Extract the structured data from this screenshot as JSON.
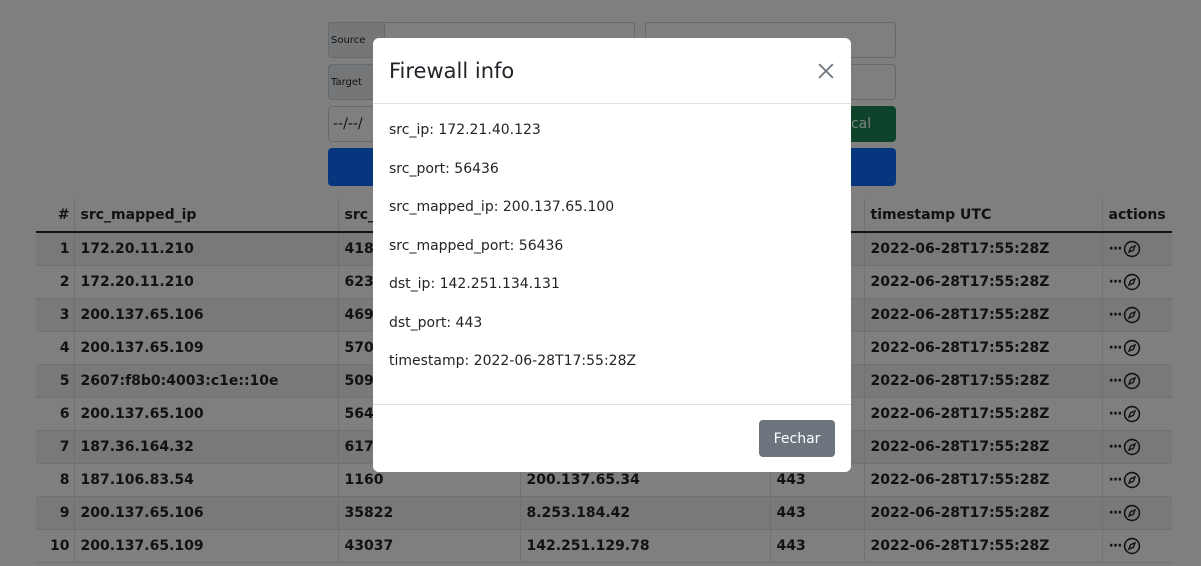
{
  "form": {
    "source_label": "Source",
    "target_label": "Target",
    "date_value": "--/--/",
    "local_button": "Local"
  },
  "table": {
    "headers": [
      "#",
      "src_mapped_ip",
      "src_",
      "",
      "",
      "timestamp UTC",
      "actions"
    ],
    "rows": [
      {
        "n": "1",
        "ip": "172.20.11.210",
        "port": "418",
        "dst": "",
        "dport": "",
        "ts": "2022-06-28T17:55:28Z"
      },
      {
        "n": "2",
        "ip": "172.20.11.210",
        "port": "623",
        "dst": "",
        "dport": "",
        "ts": "2022-06-28T17:55:28Z"
      },
      {
        "n": "3",
        "ip": "200.137.65.106",
        "port": "469",
        "dst": "",
        "dport": "",
        "ts": "2022-06-28T17:55:28Z"
      },
      {
        "n": "4",
        "ip": "200.137.65.109",
        "port": "570",
        "dst": "",
        "dport": "",
        "ts": "2022-06-28T17:55:28Z"
      },
      {
        "n": "5",
        "ip": "2607:f8b0:4003:c1e::10e",
        "port": "509",
        "dst": "",
        "dport": "",
        "ts": "2022-06-28T17:55:28Z"
      },
      {
        "n": "6",
        "ip": "200.137.65.100",
        "port": "564",
        "dst": "",
        "dport": "",
        "ts": "2022-06-28T17:55:28Z"
      },
      {
        "n": "7",
        "ip": "187.36.164.32",
        "port": "617",
        "dst": "",
        "dport": "",
        "ts": "2022-06-28T17:55:28Z"
      },
      {
        "n": "8",
        "ip": "187.106.83.54",
        "port": "1160",
        "dst": "200.137.65.34",
        "dport": "443",
        "ts": "2022-06-28T17:55:28Z"
      },
      {
        "n": "9",
        "ip": "200.137.65.106",
        "port": "35822",
        "dst": "8.253.184.42",
        "dport": "443",
        "ts": "2022-06-28T17:55:28Z"
      },
      {
        "n": "10",
        "ip": "200.137.65.109",
        "port": "43037",
        "dst": "142.251.129.78",
        "dport": "443",
        "ts": "2022-06-28T17:55:28Z"
      }
    ],
    "actions_dots": "···"
  },
  "modal": {
    "title": "Firewall info",
    "fields": {
      "src_ip": "src_ip: 172.21.40.123",
      "src_port": "src_port: 56436",
      "src_mapped_ip": "src_mapped_ip: 200.137.65.100",
      "src_mapped_port": "src_mapped_port: 56436",
      "dst_ip": "dst_ip: 142.251.134.131",
      "dst_port": "dst_port: 443",
      "timestamp": "timestamp: 2022-06-28T17:55:28Z"
    },
    "close_button": "Fechar"
  },
  "colors": {
    "backdrop": "#000000",
    "search_button": "#0d6efd",
    "local_button": "#198754",
    "footer_button": "#6c757d"
  }
}
